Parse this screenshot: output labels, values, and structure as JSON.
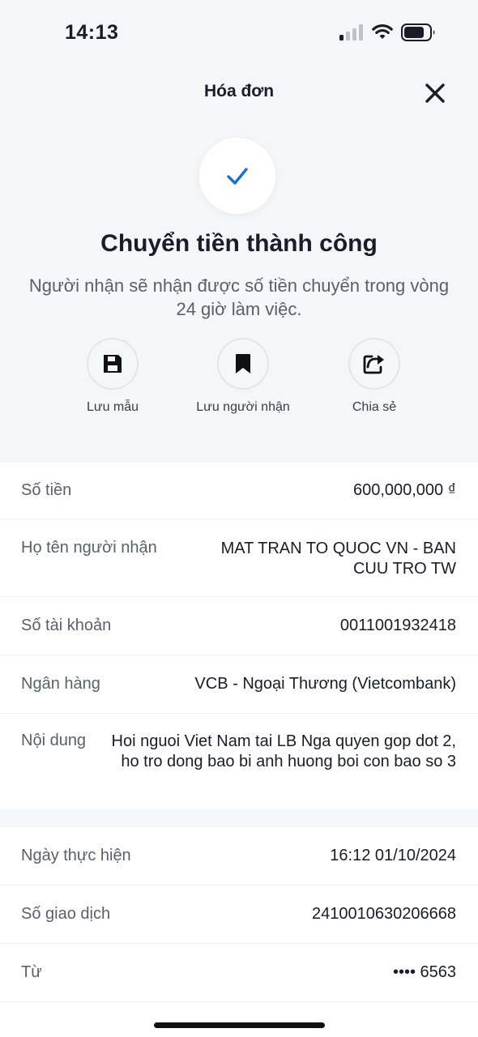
{
  "status_bar": {
    "time": "14:13"
  },
  "header": {
    "title": "Hóa đơn"
  },
  "success": {
    "title": "Chuyển tiền thành công",
    "subtitle": "Người nhận sẽ nhận được số tiền chuyển trong vòng 24 giờ làm việc."
  },
  "actions": [
    {
      "label": "Lưu mẫu",
      "icon": "save-icon"
    },
    {
      "label": "Lưu người nhận",
      "icon": "bookmark-icon"
    },
    {
      "label": "Chia sẻ",
      "icon": "share-icon"
    }
  ],
  "details": [
    {
      "key": "Số tiền",
      "value": "600,000,000 ₫"
    },
    {
      "key": "Họ tên người nhận",
      "value": "MAT TRAN TO QUOC VN - BAN CUU TRO TW"
    },
    {
      "key": "Số tài khoản",
      "value": "0011001932418"
    },
    {
      "key": "Ngân hàng",
      "value": "VCB - Ngoại Thương (Vietcombank)"
    },
    {
      "key": "Nội dung",
      "value": "Hoi nguoi Viet Nam tai LB Nga quyen gop dot 2, ho tro dong bao bi anh huong boi con bao so 3"
    }
  ],
  "transaction": [
    {
      "key": "Ngày thực hiện",
      "value": "16:12 01/10/2024"
    },
    {
      "key": "Số giao dịch",
      "value": "2410010630206668"
    },
    {
      "key": "Từ",
      "value": "•••• 6563"
    }
  ],
  "colors": {
    "accent": "#1a6ed8",
    "text": "#1a1d29",
    "muted": "#5b5f6b",
    "background": "#f5f6f8"
  }
}
